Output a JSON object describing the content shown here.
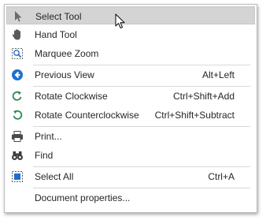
{
  "menu": {
    "items": [
      {
        "label": "Select Tool",
        "icon": "pointer-icon"
      },
      {
        "label": "Hand Tool",
        "icon": "hand-icon"
      },
      {
        "label": "Marquee Zoom",
        "icon": "marquee-zoom-icon"
      },
      {
        "label": "Previous View",
        "shortcut": "Alt+Left",
        "icon": "previous-view-icon"
      },
      {
        "label": "Rotate Clockwise",
        "shortcut": "Ctrl+Shift+Add",
        "icon": "rotate-clockwise-icon"
      },
      {
        "label": "Rotate Counterclockwise",
        "shortcut": "Ctrl+Shift+Subtract",
        "icon": "rotate-counterclockwise-icon"
      },
      {
        "label": "Print...",
        "icon": "printer-icon"
      },
      {
        "label": "Find",
        "icon": "binoculars-icon"
      },
      {
        "label": "Select All",
        "shortcut": "Ctrl+A",
        "icon": "select-all-icon"
      },
      {
        "label": "Document properties..."
      }
    ]
  },
  "colors": {
    "hover_background": "#d4d4d4",
    "accent_blue": "#1f6fcf",
    "icon_gray": "#555555",
    "text": "#262626"
  }
}
